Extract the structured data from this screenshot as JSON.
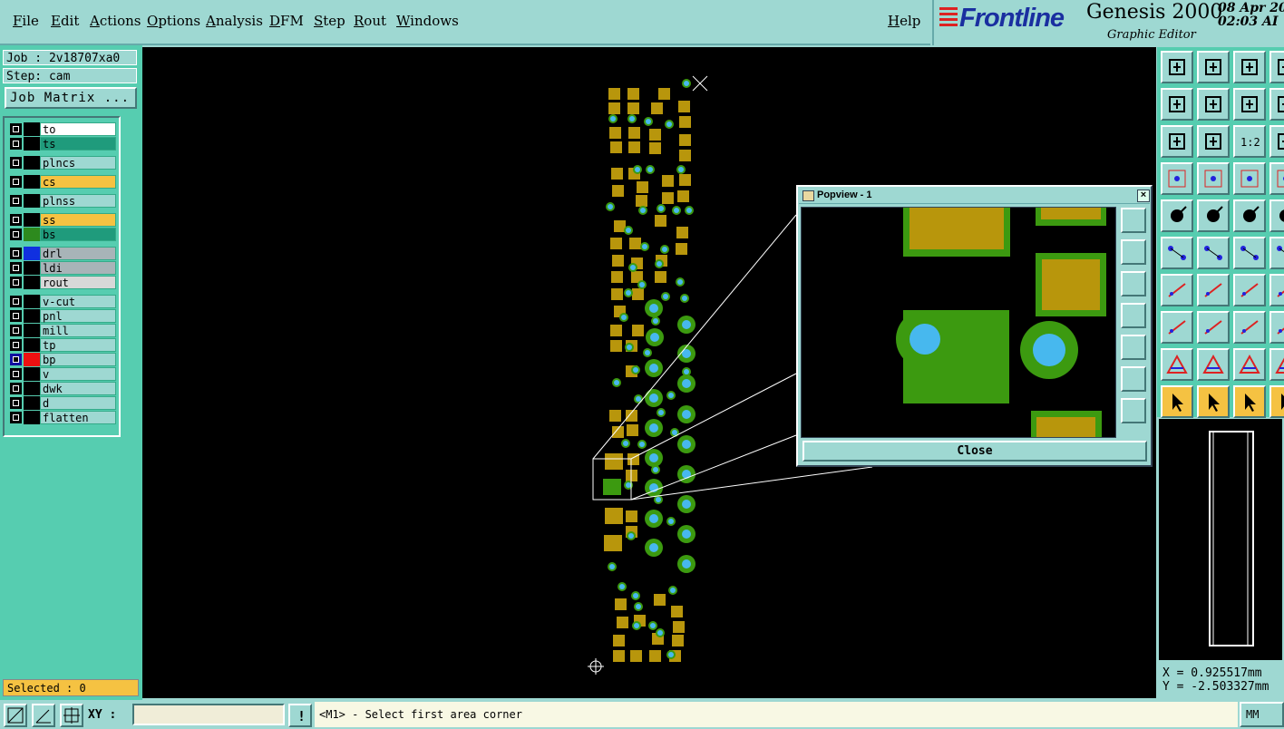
{
  "menu": {
    "items": [
      "File",
      "Edit",
      "Actions",
      "Options",
      "Analysis",
      "DFM",
      "Step",
      "Rout",
      "Windows"
    ],
    "help": "Help"
  },
  "brand": {
    "logo": "Frontline",
    "product": "Genesis 2000",
    "subtitle": "Graphic Editor",
    "date": "08 Apr 20",
    "time": "02:03 AI"
  },
  "job": {
    "job_label": "Job : 2v18707xa0",
    "step_label": "Step: cam",
    "matrix_button": "Job Matrix ..."
  },
  "layers": [
    {
      "name": "to",
      "color": "#ffffff",
      "swatch": "#000000"
    },
    {
      "name": "ts",
      "color": "#1f9b7c",
      "swatch": "#000000"
    },
    {
      "name": "plncs",
      "color": "#9ed8d2",
      "swatch": "#000000"
    },
    {
      "name": "cs",
      "color": "#f5c242",
      "swatch": "#000000"
    },
    {
      "name": "plnss",
      "color": "#9ed8d2",
      "swatch": "#000000"
    },
    {
      "name": "ss",
      "color": "#f5c242",
      "swatch": "#000000"
    },
    {
      "name": "bs",
      "color": "#1f9b7c",
      "swatch": "#2d8a1e"
    },
    {
      "name": "drl",
      "color": "#a8b4b8",
      "swatch": "#1030e0"
    },
    {
      "name": "ldi",
      "color": "#a8b4b8",
      "swatch": "#000000"
    },
    {
      "name": "rout",
      "color": "#d8d8d8",
      "swatch": "#000000"
    },
    {
      "name": "v-cut",
      "color": "#9ed8d2",
      "swatch": "#000000"
    },
    {
      "name": "pnl",
      "color": "#9ed8d2",
      "swatch": "#000000"
    },
    {
      "name": "mill",
      "color": "#9ed8d2",
      "swatch": "#000000"
    },
    {
      "name": "tp",
      "color": "#9ed8d2",
      "swatch": "#000000"
    },
    {
      "name": "bp",
      "color": "#9ed8d2",
      "swatch": "#ee1111"
    },
    {
      "name": "v",
      "color": "#9ed8d2",
      "swatch": "#000000"
    },
    {
      "name": "dwk",
      "color": "#9ed8d2",
      "swatch": "#000000"
    },
    {
      "name": "d",
      "color": "#9ed8d2",
      "swatch": "#000000"
    },
    {
      "name": "flatten",
      "color": "#9ed8d2",
      "swatch": "#000000"
    }
  ],
  "status": {
    "selected": "Selected : 0",
    "xy_label": "XY :",
    "xy_value": "",
    "message": "<M1> - Select first area corner",
    "units": "MM"
  },
  "popview": {
    "title": "Popview - 1",
    "close_label": "Close"
  },
  "coords": {
    "x": "X = 0.925517mm",
    "y": "Y = -2.503327mm"
  },
  "colors": {
    "pad_gold": "#b8960c",
    "pad_green": "#3c9a10",
    "drill_blue": "#47b8ee",
    "panel_teal": "#9ed8d2",
    "panel_green": "#56cdb0"
  }
}
